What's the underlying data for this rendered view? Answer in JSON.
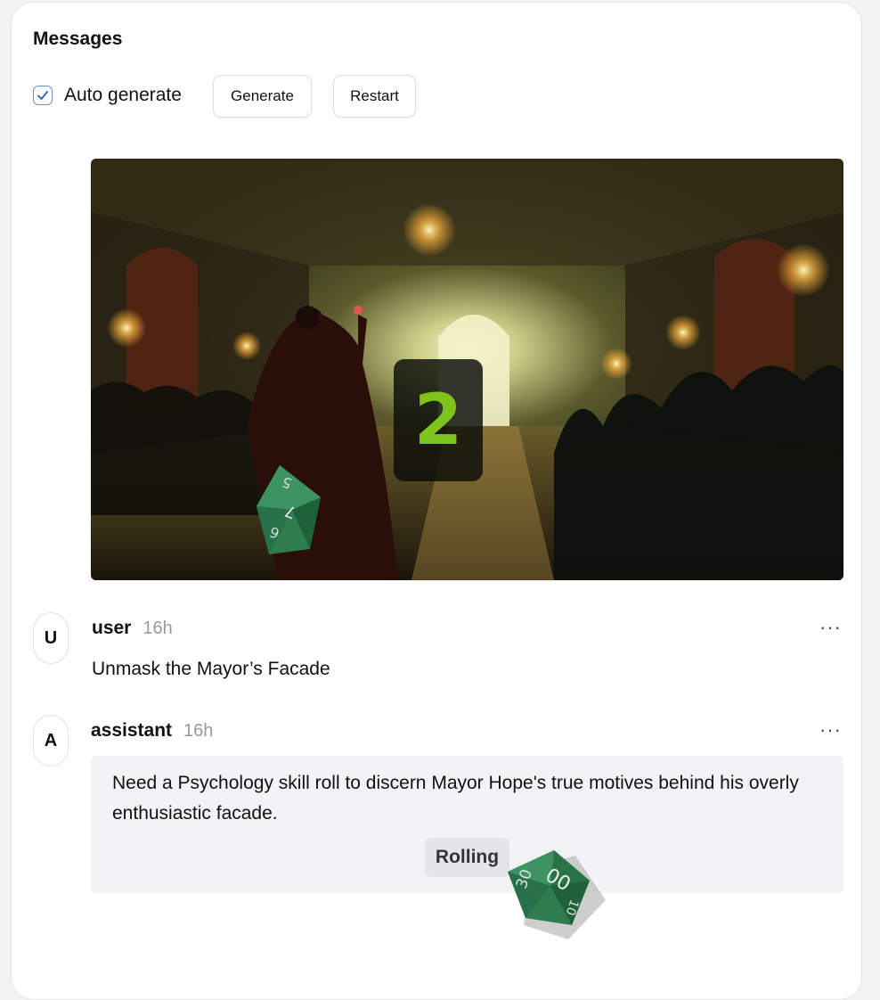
{
  "header": {
    "title": "Messages",
    "auto_generate_label": "Auto generate",
    "auto_generate_checked": true,
    "generate_label": "Generate",
    "restart_label": "Restart"
  },
  "scene": {
    "roll_result": "2",
    "die_faces": [
      "5",
      "7",
      "6"
    ],
    "icons": [
      "d10-die-icon"
    ]
  },
  "messages": [
    {
      "avatar": "U",
      "author": "user",
      "time": "16h",
      "text": "Unmask the Mayor’s Facade",
      "more_label": "···"
    },
    {
      "avatar": "A",
      "author": "assistant",
      "time": "16h",
      "text": "Need a Psychology skill roll to discern Mayor Hope's true motives behind his overly enthusiastic facade.",
      "status_label": "Rolling",
      "die_faces": [
        "30",
        "00",
        "10"
      ],
      "more_label": "···"
    }
  ],
  "colors": {
    "accent": "#6b8fc7",
    "die_green": "#2e7d4f",
    "result_green": "#7fc41c",
    "bubble_bg": "#f2f3f5"
  }
}
